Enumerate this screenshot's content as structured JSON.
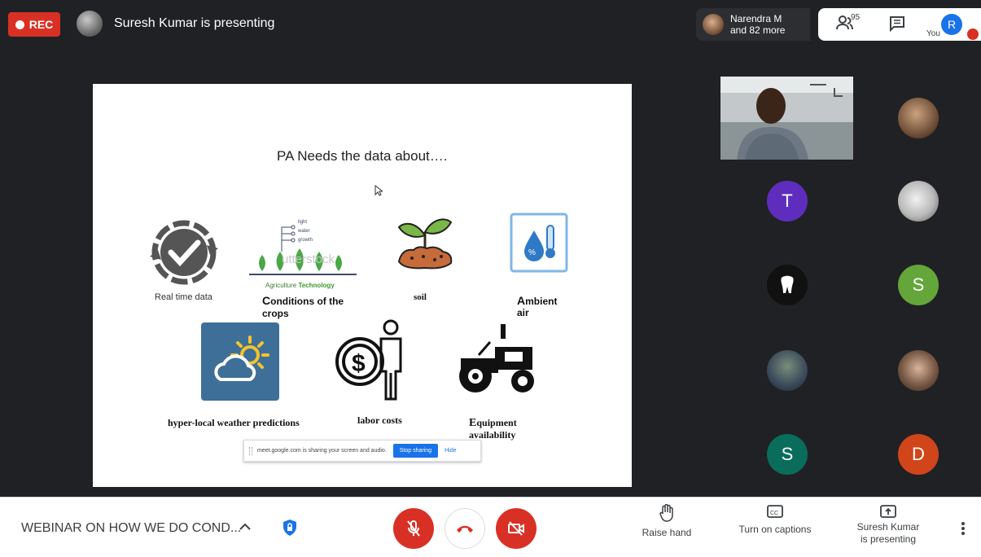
{
  "topbar": {
    "rec_label": "REC",
    "presenting_title": "Suresh Kumar is presenting",
    "participants_line1": "Narendra M",
    "participants_line2": "and 82 more",
    "people_count": "95",
    "you_label": "You",
    "you_initial": "R"
  },
  "slide": {
    "title": "PA Needs the data about….",
    "items": [
      {
        "label": "Real time data"
      },
      {
        "label_initial": "C",
        "label_rest": "onditions of the",
        "label_line2": "crops"
      },
      {
        "label": "soil"
      },
      {
        "label_initial": "A",
        "label_rest": "mbient",
        "label_line2": "air"
      },
      {
        "label": "hyper-local weather predictions"
      },
      {
        "label": "labor costs"
      },
      {
        "label_initial": "E",
        "label_rest": "quipment",
        "label_line2": "availability"
      }
    ],
    "agri_caption_1": "Agriculture ",
    "agri_caption_2": "Technology",
    "agri_watermark": "utterstock",
    "agri_rows": [
      "light",
      "water",
      "growth"
    ],
    "share_bar": {
      "text": "meet.google.com is sharing your screen and audio.",
      "stop_label": "Stop sharing",
      "hide_label": "Hide"
    }
  },
  "tiles": [
    {
      "name": "tile-t",
      "initial": "T",
      "color": "#5f2dbd"
    },
    {
      "name": "tile-s1",
      "initial": "S",
      "color": "#64a63a"
    },
    {
      "name": "tile-s2",
      "initial": "S",
      "color": "#0a6d5c"
    },
    {
      "name": "tile-d",
      "initial": "D",
      "color": "#d1451b"
    }
  ],
  "bottombar": {
    "meeting_title": "WEBINAR ON HOW WE DO COND...",
    "raise_hand_label": "Raise hand",
    "captions_label": "Turn on captions",
    "present_label_1": "Suresh Kumar",
    "present_label_2": "is presenting",
    "mic_state": "muted",
    "camera_state": "off",
    "colors": {
      "danger": "#d93025",
      "accent": "#1a73e8"
    }
  }
}
